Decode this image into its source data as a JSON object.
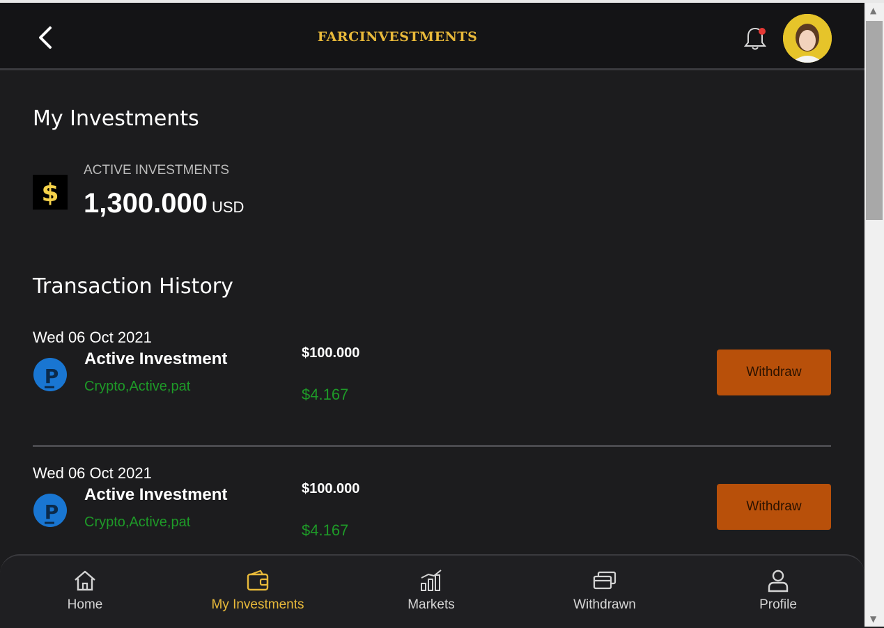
{
  "header": {
    "brand": "FARCINVESTMENTS",
    "icons": {
      "back": "chevron-left-icon",
      "bell": "bell-icon",
      "avatar": "user-avatar"
    }
  },
  "main": {
    "title": "My Investments",
    "active": {
      "label": "ACTIVE INVESTMENTS",
      "amount": "1,300.000",
      "currency": "USD"
    },
    "history_title": "Transaction History",
    "transactions": [
      {
        "date": "Wed 06 Oct 2021",
        "name": "Active Investment",
        "tags": "Crypto,Active,pat",
        "amount": "$100.000",
        "profit": "$4.167",
        "button": "Withdraw"
      },
      {
        "date": "Wed 06 Oct 2021",
        "name": "Active Investment",
        "tags": "Crypto,Active,pat",
        "amount": "$100.000",
        "profit": "$4.167",
        "button": "Withdraw"
      }
    ]
  },
  "nav": {
    "items": [
      {
        "label": "Home",
        "icon": "home-icon"
      },
      {
        "label": "My Investments",
        "icon": "wallet-icon",
        "active": true
      },
      {
        "label": "Markets",
        "icon": "chart-icon"
      },
      {
        "label": "Withdrawn",
        "icon": "cards-icon"
      },
      {
        "label": "Profile",
        "icon": "user-icon"
      }
    ]
  },
  "colors": {
    "brand": "#e8b93a",
    "background": "#1c1c1e",
    "profit_green": "#1e9a28",
    "withdraw_button": "#b8500a",
    "notification_dot": "#e53935"
  }
}
